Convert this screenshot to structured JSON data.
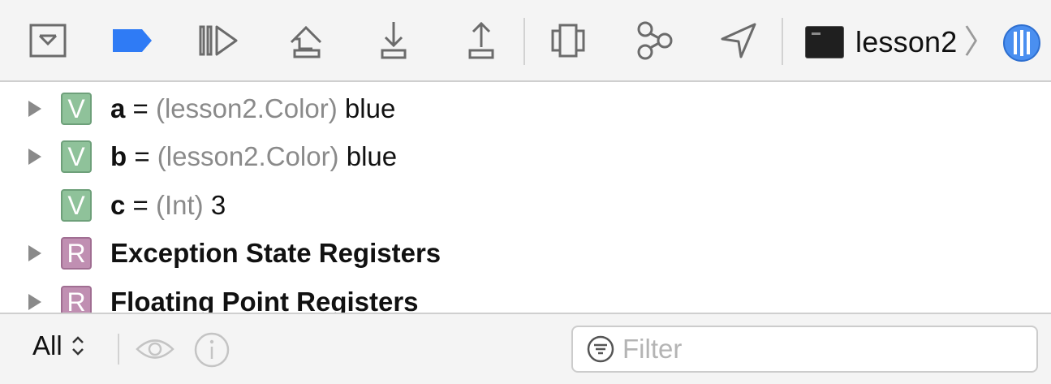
{
  "toolbar": {
    "buttons": [
      {
        "icon": "hide-debug-area-icon"
      },
      {
        "icon": "breakpoints-toggle-icon",
        "color": "#2f7bf5"
      },
      {
        "icon": "continue-icon"
      },
      {
        "icon": "step-over-icon"
      },
      {
        "icon": "step-into-icon"
      },
      {
        "icon": "step-out-icon"
      },
      {
        "icon": "view-hierarchy-icon"
      },
      {
        "icon": "memory-graph-icon"
      },
      {
        "icon": "simulate-location-icon"
      }
    ],
    "scheme": {
      "icon": "terminal-app-icon",
      "label": "lesson2",
      "separator": "〉",
      "device_icon": "thread-queue-icon",
      "device_color": "#4a8ff0"
    }
  },
  "variables": {
    "rows": [
      {
        "kind": "V",
        "expandable": true,
        "name": "a",
        "eq": "=",
        "type": "(lesson2.Color)",
        "value": "blue"
      },
      {
        "kind": "V",
        "expandable": true,
        "name": "b",
        "eq": "=",
        "type": "(lesson2.Color)",
        "value": "blue"
      },
      {
        "kind": "V",
        "expandable": false,
        "name": "c",
        "eq": "=",
        "type": "(Int)",
        "value": "3"
      },
      {
        "kind": "R",
        "expandable": true,
        "group": "Exception State Registers"
      },
      {
        "kind": "R",
        "expandable": true,
        "group": "Floating Point Registers"
      }
    ],
    "badge_colors": {
      "V": "#8fc29a",
      "R": "#c08fb2"
    }
  },
  "bottom": {
    "scope_label": "All",
    "filter_placeholder": "Filter",
    "filter_value": ""
  }
}
